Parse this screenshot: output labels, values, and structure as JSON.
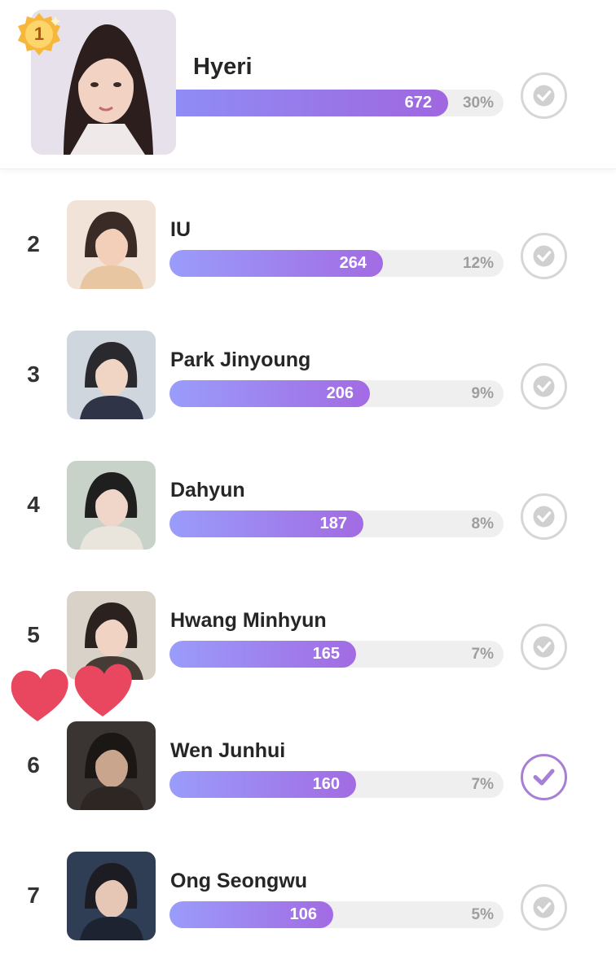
{
  "top": {
    "rank": "1",
    "name": "Hyeri",
    "votes": "672",
    "percent": "30%",
    "share": 0.3
  },
  "rows": [
    {
      "rank": "2",
      "name": "IU",
      "votes": "264",
      "percent": "12%",
      "share": 0.12,
      "checked": false
    },
    {
      "rank": "3",
      "name": "Park Jinyoung",
      "votes": "206",
      "percent": "9%",
      "share": 0.09,
      "checked": false
    },
    {
      "rank": "4",
      "name": "Dahyun",
      "votes": "187",
      "percent": "8%",
      "share": 0.08,
      "checked": false
    },
    {
      "rank": "5",
      "name": "Hwang Minhyun",
      "votes": "165",
      "percent": "7%",
      "share": 0.07,
      "checked": false
    },
    {
      "rank": "6",
      "name": "Wen Junhui",
      "votes": "160",
      "percent": "7%",
      "share": 0.07,
      "checked": true
    },
    {
      "rank": "7",
      "name": "Ong Seongwu",
      "votes": "106",
      "percent": "5%",
      "share": 0.05,
      "checked": false
    }
  ],
  "colors": {
    "bar_start": "#9a9cfb",
    "bar_end": "#a26be3",
    "check_inactive": "#d6d6d6",
    "check_active": "#a77fd6",
    "heart": "#e8475f",
    "medal_gold": "#f6b73c"
  },
  "icons": {
    "check": "check-circle-icon",
    "medal": "gold-medal-icon",
    "hearts": "heart-icon"
  }
}
